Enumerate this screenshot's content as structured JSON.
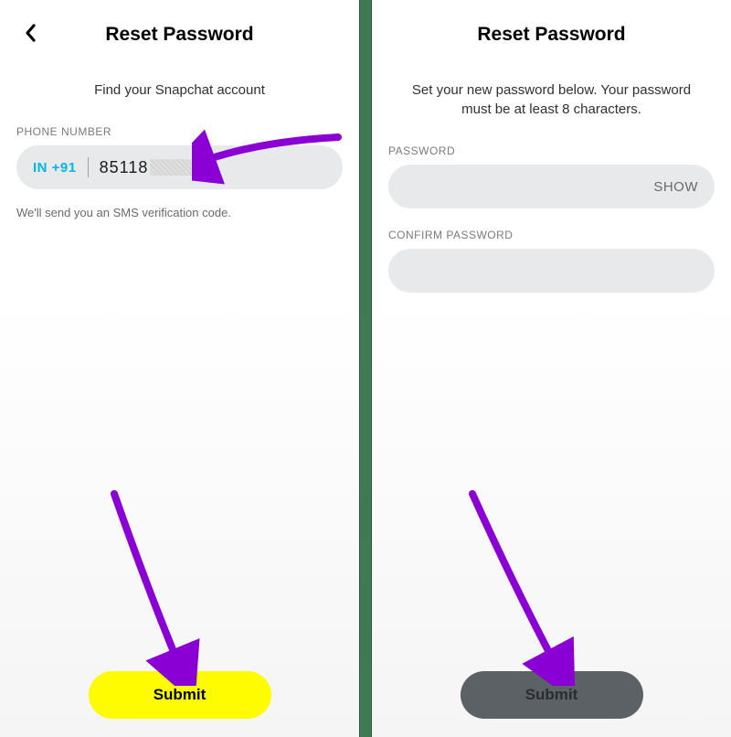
{
  "left": {
    "title": "Reset Password",
    "subtitle": "Find your Snapchat account",
    "phone_label": "PHONE NUMBER",
    "country_code": "IN +91",
    "phone_value": "85118",
    "helper": "We'll send you an SMS verification code.",
    "submit_label": "Submit"
  },
  "right": {
    "title": "Reset Password",
    "subtitle": "Set your new password below. Your password must be at least 8 characters.",
    "password_label": "PASSWORD",
    "show_label": "SHOW",
    "confirm_label": "CONFIRM PASSWORD",
    "submit_label": "Submit"
  },
  "colors": {
    "accent_yellow": "#fffc00",
    "country_code_blue": "#00b5e8",
    "arrow_purple": "#8a00d4",
    "divider_green": "#3f7a54"
  }
}
